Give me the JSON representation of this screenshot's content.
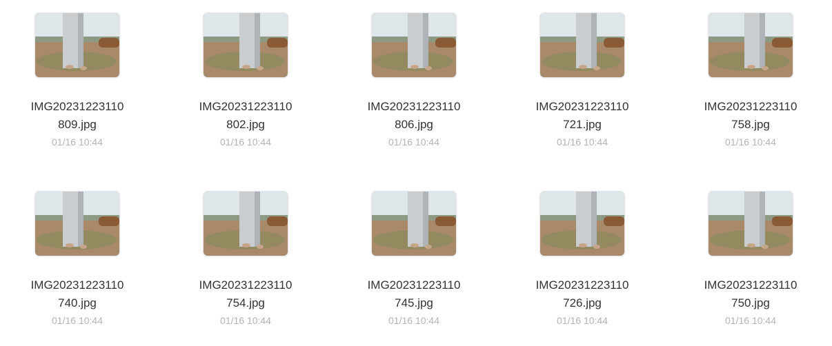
{
  "files": [
    {
      "name_line1": "IMG20231223110",
      "name_line2": "809.jpg",
      "date": "01/16 10:44",
      "photo_icon": "concrete-pillar-photo",
      "pillar_pos": "left"
    },
    {
      "name_line1": "IMG20231223110",
      "name_line2": "802.jpg",
      "date": "01/16 10:44",
      "photo_icon": "concrete-pillar-photo",
      "pillar_pos": "center"
    },
    {
      "name_line1": "IMG20231223110",
      "name_line2": "806.jpg",
      "date": "01/16 10:44",
      "photo_icon": "concrete-pillar-photo",
      "pillar_pos": "center"
    },
    {
      "name_line1": "IMG20231223110",
      "name_line2": "721.jpg",
      "date": "01/16 10:44",
      "photo_icon": "concrete-pillar-photo",
      "pillar_pos": "center"
    },
    {
      "name_line1": "IMG20231223110",
      "name_line2": "758.jpg",
      "date": "01/16 10:44",
      "photo_icon": "concrete-pillar-photo",
      "pillar_pos": "center"
    },
    {
      "name_line1": "IMG20231223110",
      "name_line2": "740.jpg",
      "date": "01/16 10:44",
      "photo_icon": "concrete-pillar-photo",
      "pillar_pos": "left"
    },
    {
      "name_line1": "IMG20231223110",
      "name_line2": "754.jpg",
      "date": "01/16 10:44",
      "photo_icon": "concrete-pillar-photo",
      "pillar_pos": "center"
    },
    {
      "name_line1": "IMG20231223110",
      "name_line2": "745.jpg",
      "date": "01/16 10:44",
      "photo_icon": "concrete-pillar-photo",
      "pillar_pos": "center"
    },
    {
      "name_line1": "IMG20231223110",
      "name_line2": "726.jpg",
      "date": "01/16 10:44",
      "photo_icon": "concrete-pillar-photo",
      "pillar_pos": "center"
    },
    {
      "name_line1": "IMG20231223110",
      "name_line2": "750.jpg",
      "date": "01/16 10:44",
      "photo_icon": "concrete-pillar-photo",
      "pillar_pos": "center"
    }
  ],
  "colors": {
    "name_text": "#333333",
    "date_text": "#b0b3b8",
    "sky": "#dfe6ea",
    "ground": "#a88a6b",
    "water": "#8f8a5e",
    "pillar": "#c9cdd0",
    "pipe": "#8a5a35"
  }
}
